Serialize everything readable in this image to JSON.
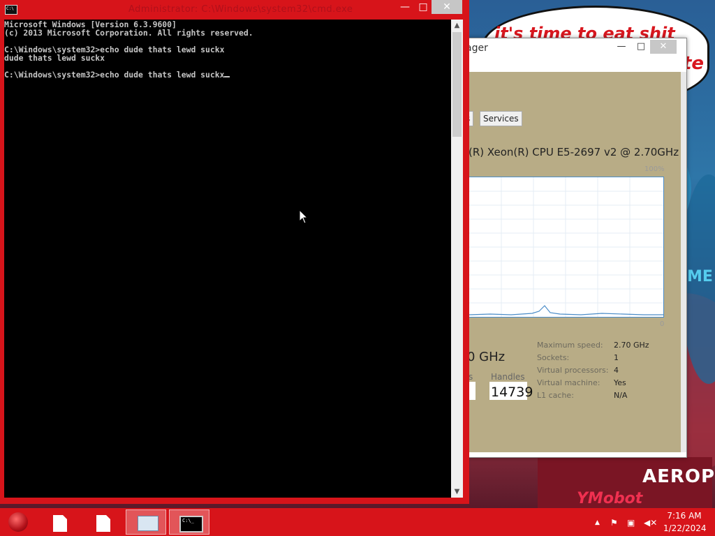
{
  "desktop": {
    "bubble_text": "it's time to eat shit",
    "bubble_text_tail": "te",
    "sign_text": "AEROPOS",
    "sign_text_2": "YMobot",
    "side_text": "ME"
  },
  "cmd": {
    "title": "Administrator: C:\\Windows\\system32\\cmd.exe",
    "icon_label": "C:\\",
    "lines": [
      "Microsoft Windows [Version 6.3.9600]",
      "(c) 2013 Microsoft Corporation. All rights reserved.",
      "",
      "C:\\Windows\\system32>echo dude thats lewd suckx",
      "dude thats lewd suckx",
      "",
      "C:\\Windows\\system32>echo dude thats lewd suckx"
    ],
    "controls": {
      "minimize": "—",
      "maximize": "□",
      "close": "✕"
    }
  },
  "taskmgr": {
    "title_fragment": "ager",
    "controls": {
      "minimize": "—",
      "maximize": "□",
      "close": "✕"
    },
    "tab_partial": "s",
    "tab_services": "Services",
    "cpu_name": "(R) Xeon(R) CPU E5-2697 v2 @ 2.70GHz",
    "graph_max_label": "100%",
    "graph_min_label": "0",
    "speed_fragment": "0 GHz",
    "left_label_fragment": "s",
    "handles_label": "Handles",
    "handles_value": "14739",
    "stats": [
      {
        "label": "Maximum speed:",
        "value": "2.70 GHz"
      },
      {
        "label": "Sockets:",
        "value": "1"
      },
      {
        "label": "Virtual processors:",
        "value": "4"
      },
      {
        "label": "Virtual machine:",
        "value": "Yes"
      },
      {
        "label": "L1 cache:",
        "value": "N/A"
      }
    ]
  },
  "taskbar": {
    "time": "7:16 AM",
    "date": "1/22/2024",
    "cmd_icon_label": "C:\\_"
  },
  "colors": {
    "accent_red": "#d7141a",
    "console_bg": "#000000",
    "console_text": "#c6c6c6",
    "graph_line": "#4a8cc8"
  }
}
